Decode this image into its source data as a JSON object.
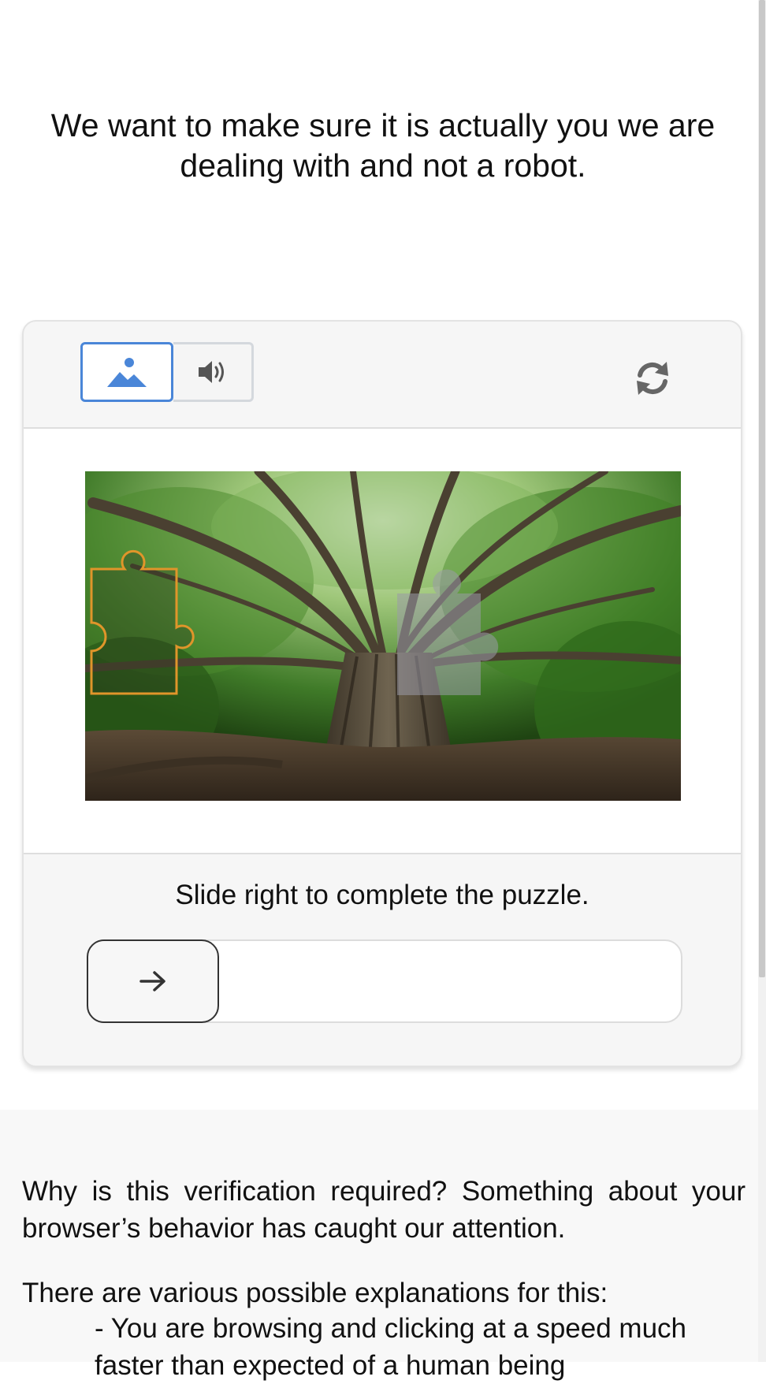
{
  "heading": "We want to make sure it is actually you we are dealing with and not a robot.",
  "captcha": {
    "modes": [
      {
        "name": "image",
        "icon": "image-icon",
        "selected": true
      },
      {
        "name": "audio",
        "icon": "speaker-icon",
        "selected": false
      }
    ],
    "refresh_icon": "refresh-icon",
    "instruction": "Slide right to complete the puzzle.",
    "slider_icon": "arrow-right-icon",
    "slider_progress": 0,
    "colors": {
      "accent": "#4a86d8",
      "piece_outline": "#e0952a"
    }
  },
  "info": {
    "why_text": "Why is this verification required? Something about your browser’s behavior has caught our attention.",
    "explanations_text": "There are various possible explanations for this:",
    "bullet_1": "- You are browsing and clicking at a speed much faster than expected of a human being"
  }
}
